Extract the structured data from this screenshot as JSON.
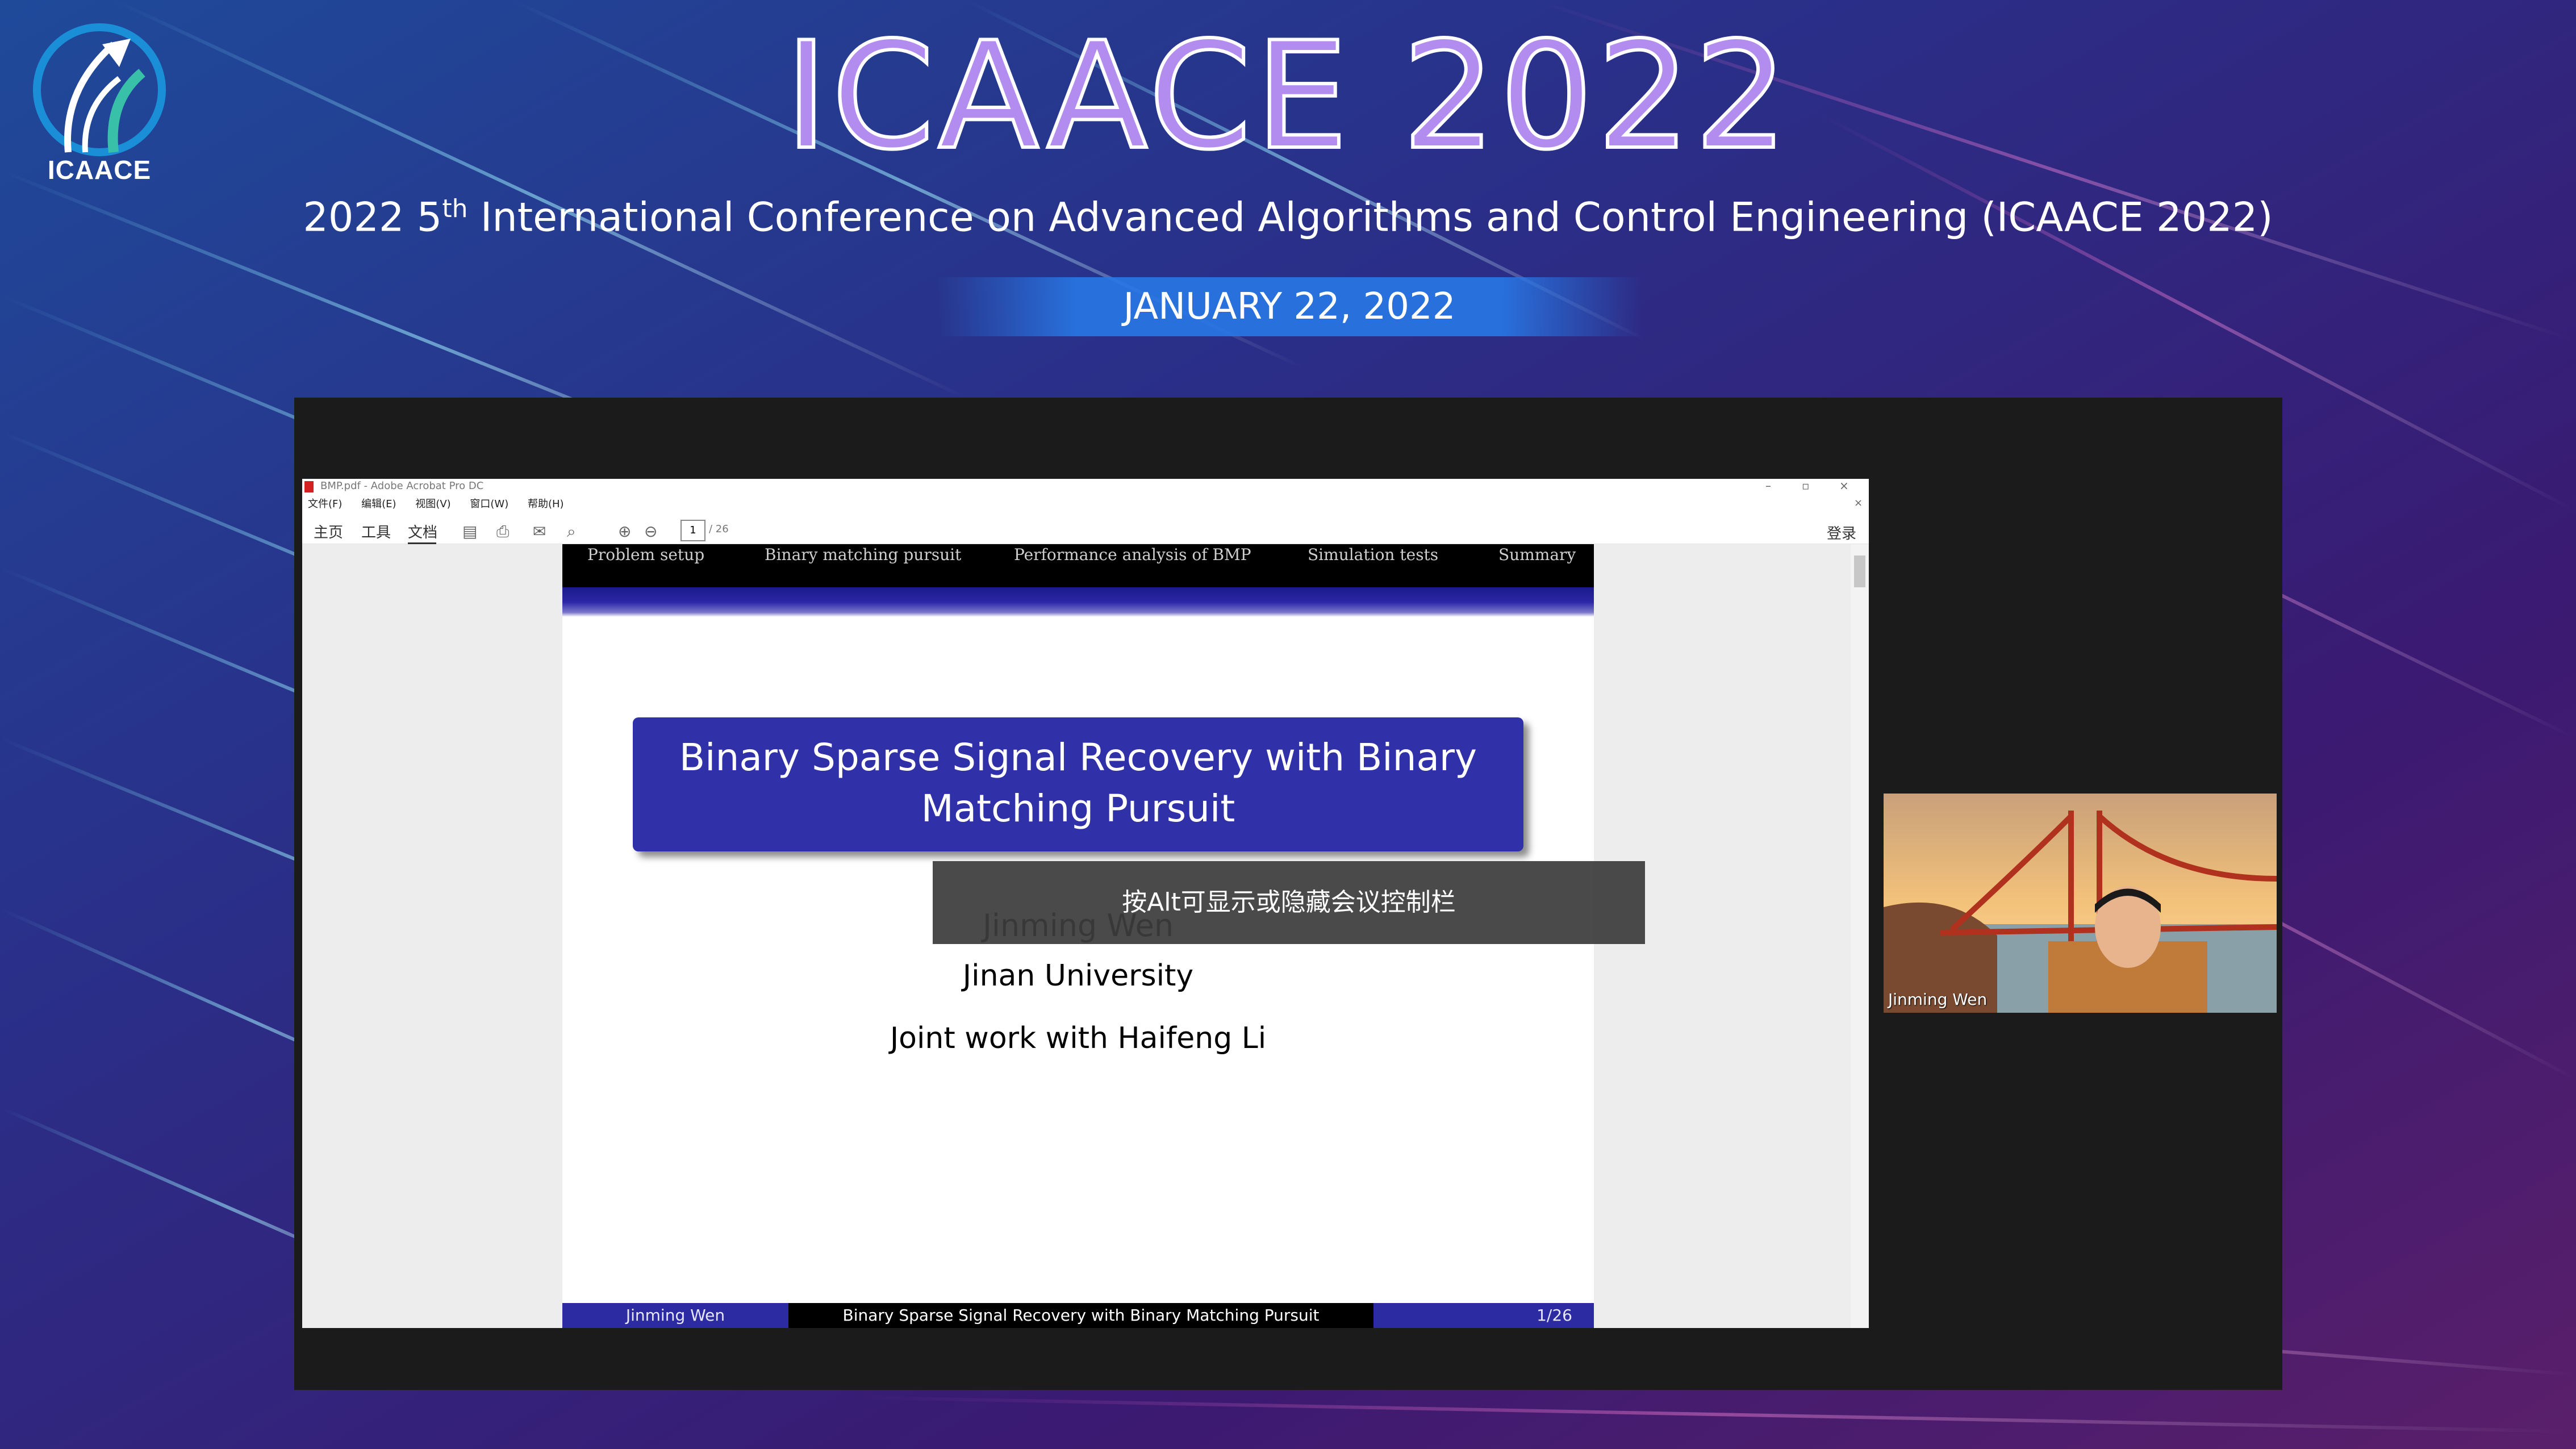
{
  "event": {
    "logo_text": "ICAACE",
    "title": "ICAACE 2022",
    "subtitle_prefix": "2022 5",
    "subtitle_sup": "th",
    "subtitle_rest": " International Conference on Advanced Algorithms and Control Engineering (ICAACE 2022)",
    "date": "JANUARY 22, 2022"
  },
  "acrobat": {
    "window_title": "BMP.pdf - Adobe Acrobat Pro DC",
    "menu": [
      "文件(F)",
      "编辑(E)",
      "视图(V)",
      "窗口(W)",
      "帮助(H)"
    ],
    "tabs": {
      "home": "主页",
      "tools": "工具",
      "document": "文档"
    },
    "page_current": "1",
    "page_total": "/ 26",
    "login": "登录"
  },
  "slide": {
    "nav": [
      "Problem setup",
      "Binary matching pursuit",
      "Performance analysis of BMP",
      "Simulation tests",
      "Summary"
    ],
    "title": "Binary Sparse Signal Recovery with Binary Matching Pursuit",
    "author": "Jinming Wen",
    "affiliation": "Jinan University",
    "joint": "Joint work with Haifeng Li",
    "footer": {
      "author": "Jinming Wen",
      "title": "Binary Sparse Signal Recovery with Binary Matching Pursuit",
      "page": "1/26"
    }
  },
  "meeting": {
    "alt_tip": "按Alt可显示或隐藏会议控制栏",
    "participant_name": "Jinming Wen"
  },
  "colors": {
    "slide_blue": "#3030a8",
    "footer_blue": "#2c2ba2",
    "stage": "#1b1b1b"
  }
}
